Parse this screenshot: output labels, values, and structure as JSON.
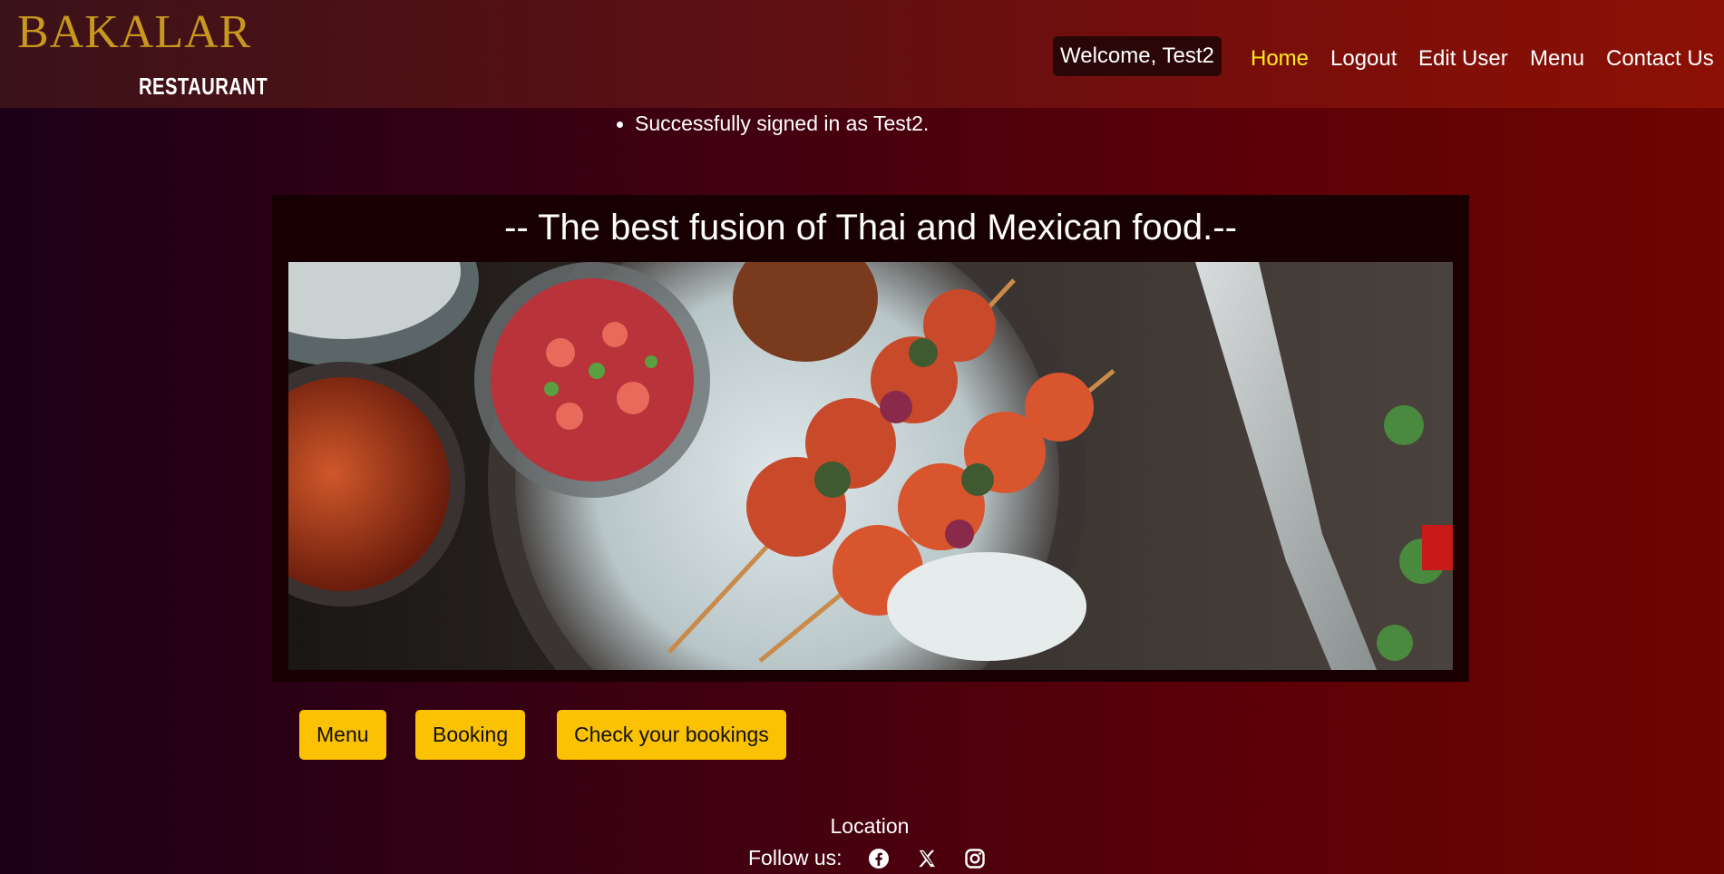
{
  "header": {
    "brand": "BAKALAR",
    "brand_sub": "RESTAURANT",
    "welcome": "Welcome, Test2",
    "nav": [
      {
        "label": "Home",
        "active": true
      },
      {
        "label": "Logout"
      },
      {
        "label": "Edit User"
      },
      {
        "label": "Menu"
      },
      {
        "label": "Contact Us"
      }
    ]
  },
  "messages": [
    "Successfully signed in as Test2."
  ],
  "hero": {
    "title": "-- The best fusion of Thai and Mexican food.--"
  },
  "actions": [
    "Menu",
    "Booking",
    "Check your bookings"
  ],
  "footer": {
    "location": "Location",
    "follow": "Follow us:",
    "social": [
      "facebook-icon",
      "x-icon",
      "instagram-icon"
    ]
  },
  "colors": {
    "brand_gold": "#c8971e",
    "button_yellow": "#fbc103",
    "nav_active": "#ffeb1a"
  }
}
